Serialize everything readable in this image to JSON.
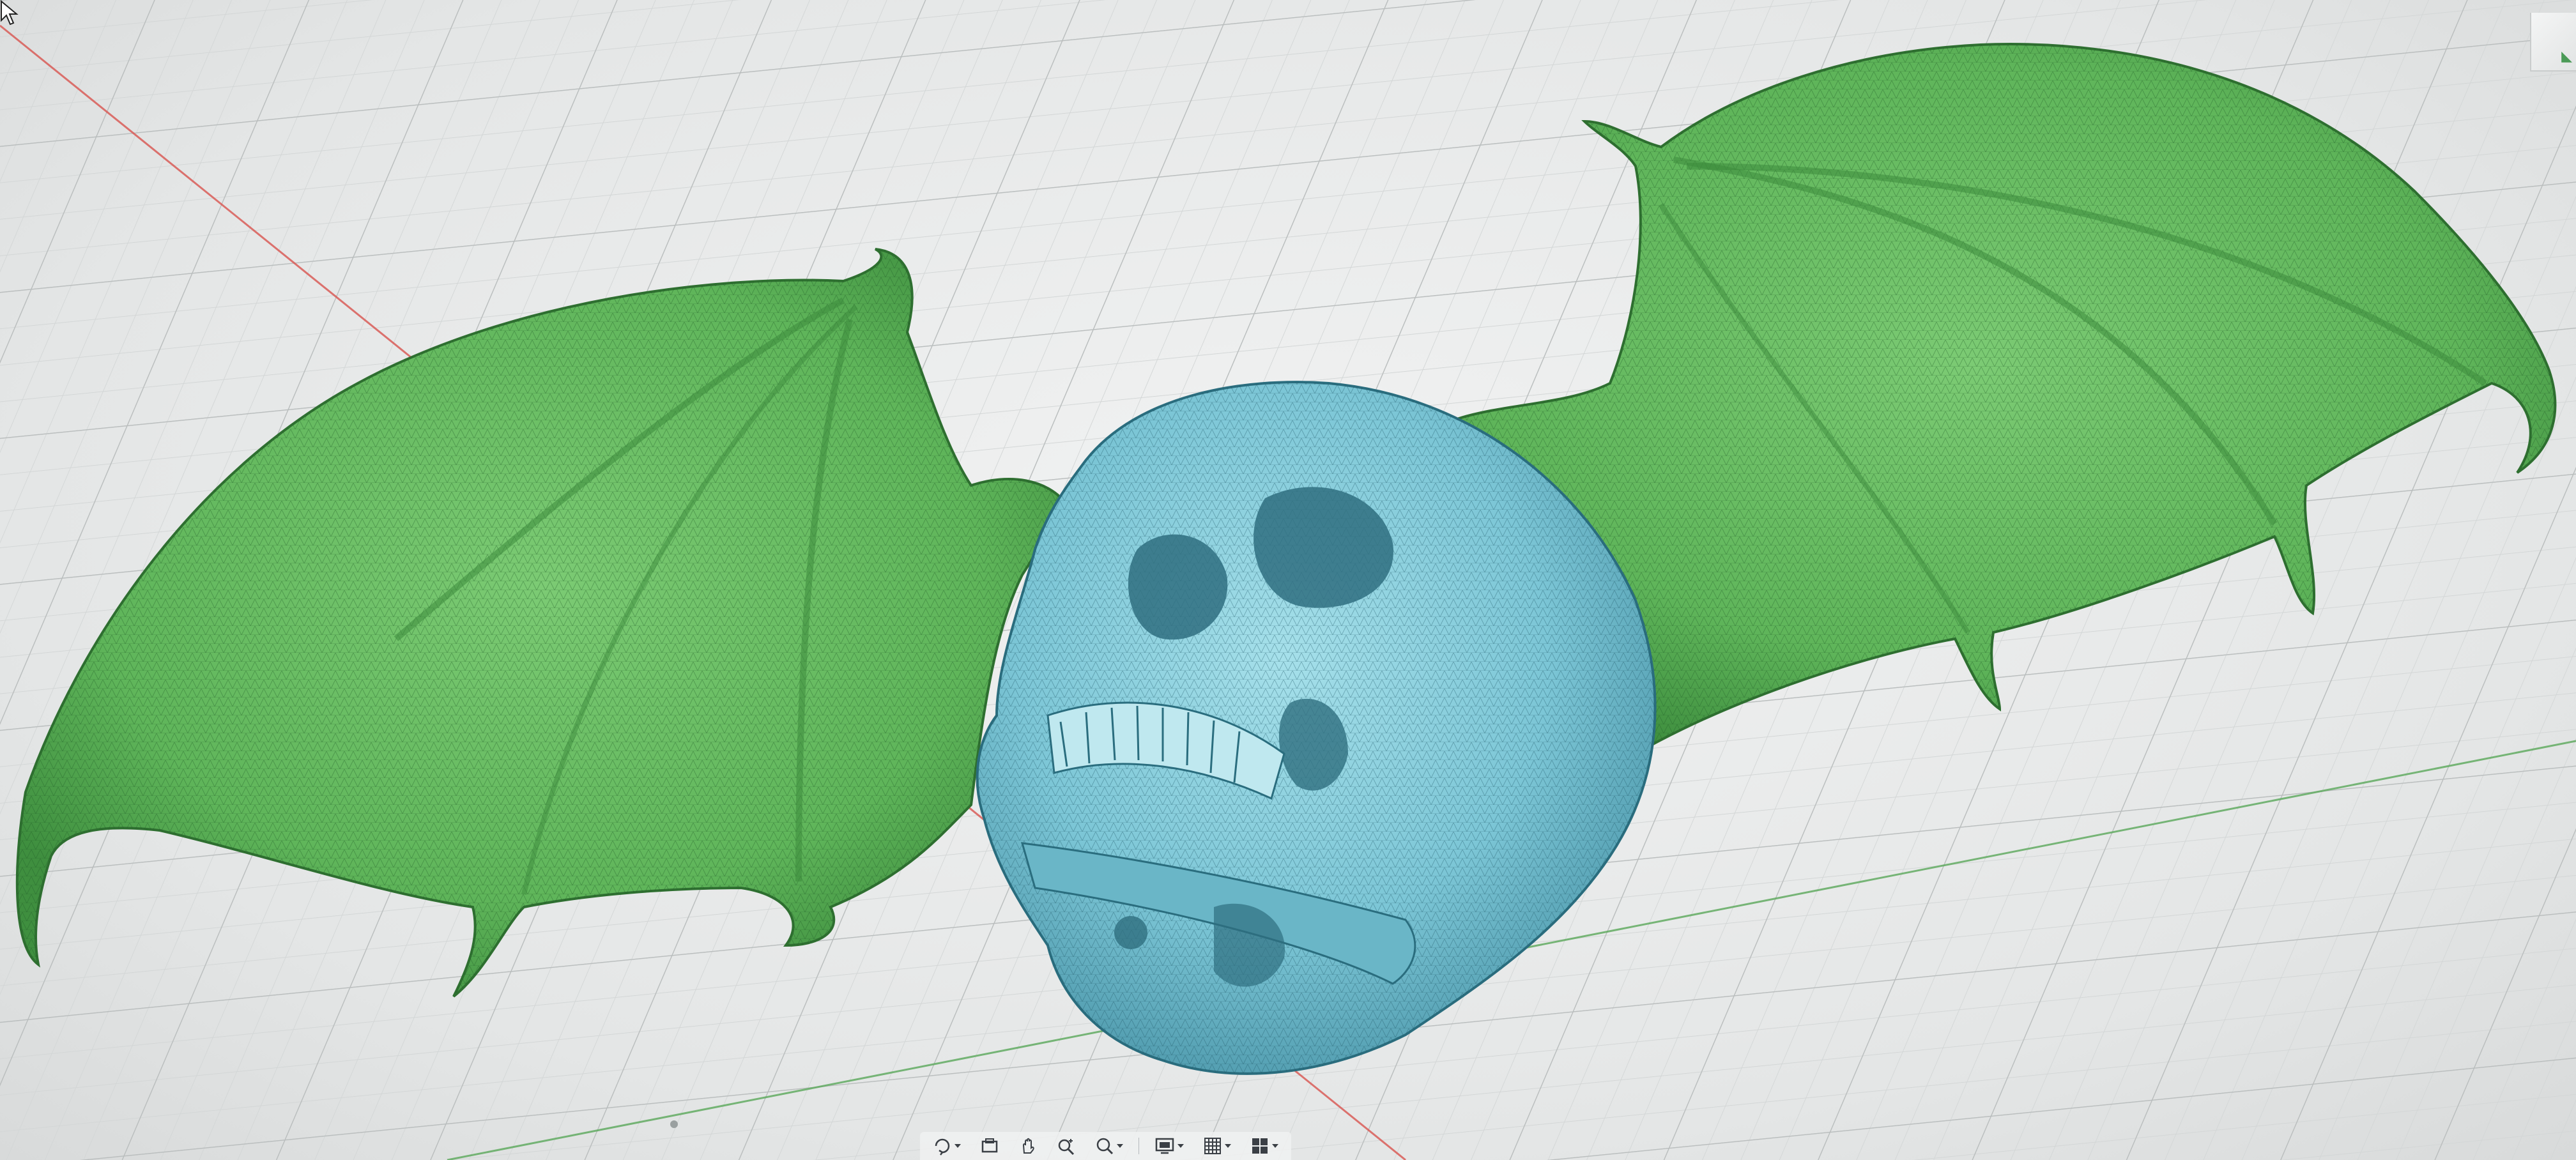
{
  "app": {
    "title": ""
  },
  "viewport": {
    "model_name": "",
    "wing_color": "#5fb55a",
    "skull_color": "#7cc6d6",
    "grid_color": "#c5c9c9",
    "x_axis_color": "#d9544f",
    "y_axis_color": "#5aa85a"
  },
  "viewcube": {
    "icon": "viewcube-icon"
  },
  "toolbar": {
    "items": [
      {
        "icon": "orbit-icon"
      },
      {
        "icon": "look-at-icon"
      },
      {
        "icon": "pan-icon"
      },
      {
        "icon": "zoom-icon"
      },
      {
        "icon": "fit-icon"
      },
      {
        "icon": "display-settings-icon"
      },
      {
        "icon": "grid-settings-icon"
      },
      {
        "icon": "viewports-icon"
      }
    ]
  }
}
